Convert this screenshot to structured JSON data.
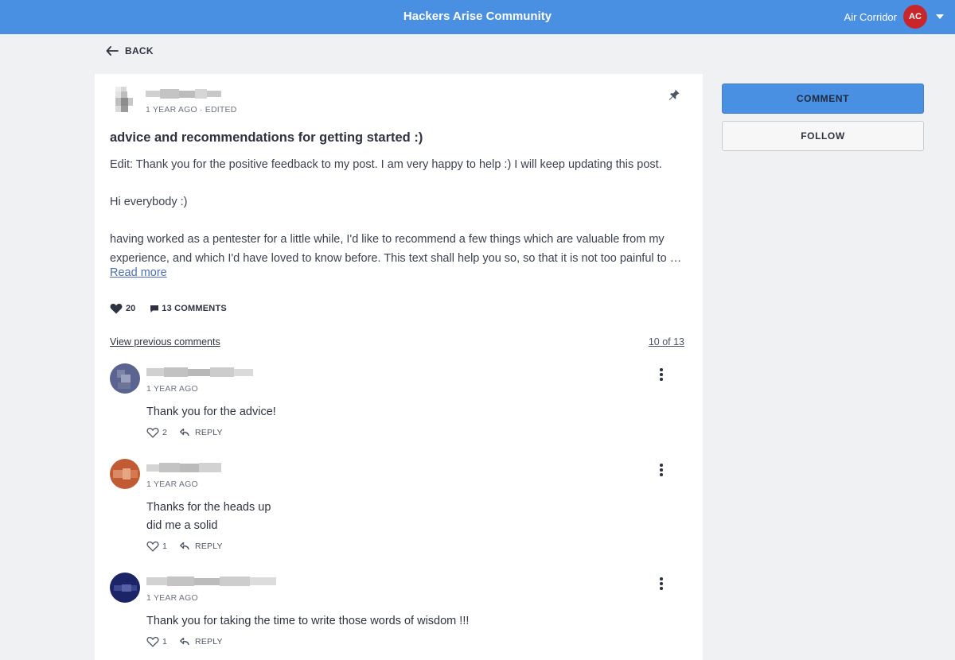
{
  "header": {
    "title": "Hackers Arise Community",
    "user_name": "Air Corridor",
    "user_initials": "AC",
    "avatar_color": "#c9262c",
    "bar_color": "#4a90e2"
  },
  "nav": {
    "back_label": "BACK"
  },
  "post": {
    "meta": "1 YEAR AGO · EDITED",
    "title": "advice and recommendations for getting started :)",
    "body_line_1": "Edit: Thank you for the positive feedback to my post. I am very happy to help :) I will keep updating this post.",
    "body_line_2": "Hi everybody :)",
    "body_line_3": "having worked as a pentester for a little while, I'd like to recommend a few things which are valuable from my",
    "body_line_4": "experience, and which I'd have loved to know before. This text shall help you so, so that it is not too painful to g…",
    "read_more": "Read more",
    "likes": "20",
    "comments_label": "13 COMMENTS"
  },
  "comments_section": {
    "view_previous": "View previous comments",
    "count": "10 of 13",
    "items": [
      {
        "time": "1 YEAR AGO",
        "text_1": "Thank you for the advice!",
        "text_2": "",
        "likes": "2",
        "reply": "REPLY"
      },
      {
        "time": "1 YEAR AGO",
        "text_1": "Thanks for the heads up",
        "text_2": "did me a solid",
        "likes": "1",
        "reply": "REPLY"
      },
      {
        "time": "1 YEAR AGO",
        "text_1": "Thank you for taking the time to write those words of wisdom !!!",
        "text_2": "",
        "likes": "1",
        "reply": "REPLY"
      }
    ]
  },
  "sidebar": {
    "comment_button": "COMMENT",
    "follow_button": "FOLLOW"
  }
}
